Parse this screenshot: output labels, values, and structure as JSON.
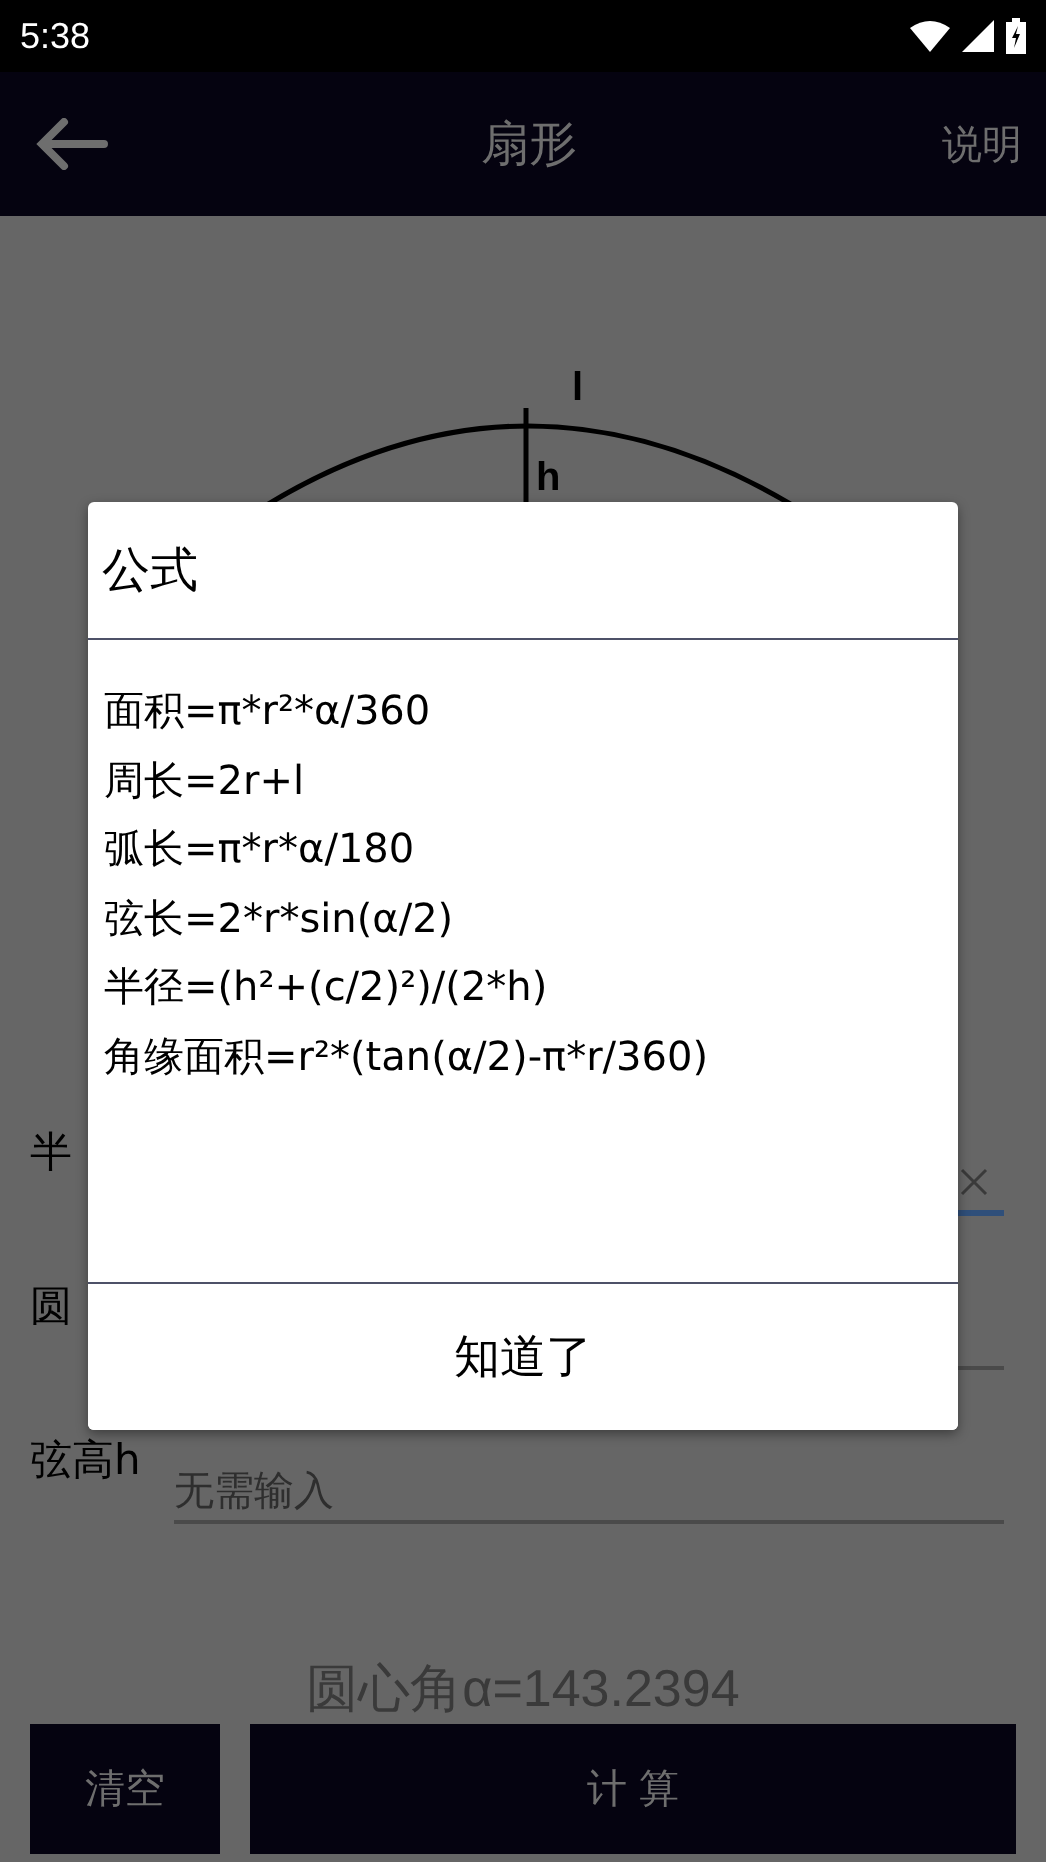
{
  "status_bar": {
    "time": "5:38"
  },
  "toolbar": {
    "title": "扇形",
    "action": "说明"
  },
  "diagram": {
    "arc_label": "l",
    "height_label": "h"
  },
  "fields": [
    {
      "label": "半",
      "focused": true
    },
    {
      "label": "圆",
      "focused": false
    },
    {
      "label": "弦高h",
      "placeholder": "无需输入",
      "focused": false
    }
  ],
  "result": "圆心角α=143.2394",
  "buttons": [
    {
      "label": "清空",
      "kind": "small"
    },
    {
      "label": "计 算",
      "kind": "wide"
    }
  ],
  "dialog": {
    "title": "公式",
    "lines": [
      "面积=π*r²*α/360",
      "周长=2r+l",
      "弧长=π*r*α/180",
      "弦长=2*r*sin(α/2)",
      "半径=(h²+(c/2)²)/(2*h)",
      "角缘面积=r²*(tan(α/2)-π*r/360)"
    ],
    "button": "知道了"
  }
}
